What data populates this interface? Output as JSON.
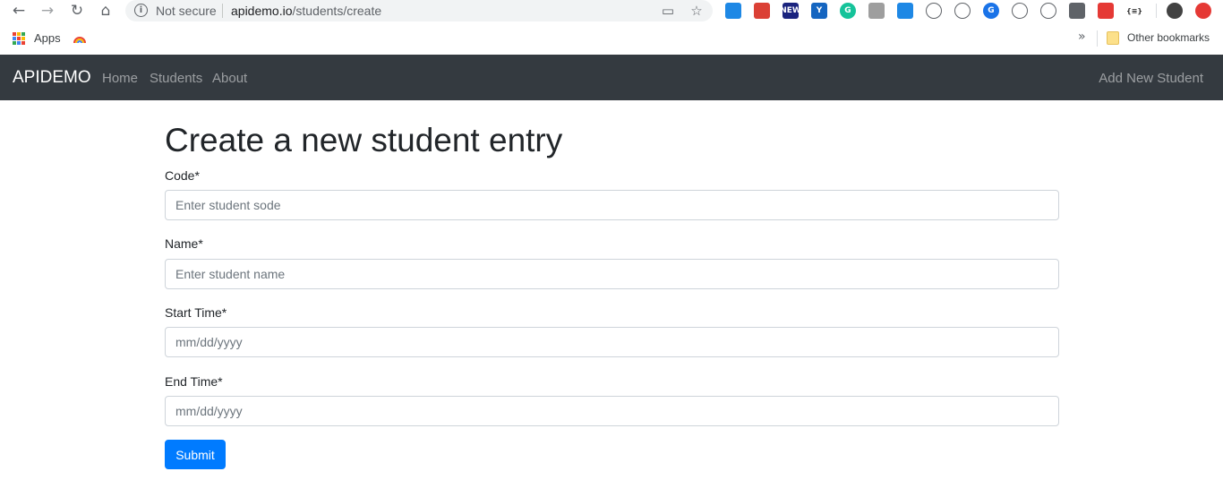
{
  "browser": {
    "security_label": "Not secure",
    "url_host": "apidemo.io",
    "url_path": "/students/create",
    "extensions": [
      {
        "name": "ext-blue-square-icon",
        "color": "#1e88e5"
      },
      {
        "name": "todoist-icon",
        "color": "#db4035"
      },
      {
        "name": "news-icon",
        "color": "#1a237e",
        "text": "NEW"
      },
      {
        "name": "y-check-icon",
        "color": "#1565c0",
        "text": "Y"
      },
      {
        "name": "grammarly-icon",
        "color": "#15c39a",
        "text": "G"
      },
      {
        "name": "profile-ext-icon",
        "color": "#9e9e9e"
      },
      {
        "name": "shield-check-icon",
        "color": "#1e88e5"
      },
      {
        "name": "lightning-icon",
        "color": "#ffffff"
      },
      {
        "name": "history-icon",
        "color": "#ffffff"
      },
      {
        "name": "g-circle-icon",
        "color": "#1a73e8",
        "text": "G"
      },
      {
        "name": "code-brackets-icon",
        "color": "#ffffff"
      },
      {
        "name": "c-clock-icon",
        "color": "#ffffff"
      },
      {
        "name": "map-pin-icon",
        "color": "#5f6368"
      },
      {
        "name": "color-grid-icon",
        "color": "#e53935"
      },
      {
        "name": "json-icon",
        "color": "#ffffff",
        "text": "{≡}"
      },
      {
        "name": "avatar-icon",
        "color": "#424242"
      },
      {
        "name": "update-arrow-icon",
        "color": "#e53935"
      }
    ]
  },
  "bookmarks": {
    "apps_label": "Apps",
    "other_label": "Other bookmarks"
  },
  "navbar": {
    "brand": "APIDEMO",
    "links": [
      "Home",
      "Students",
      "About"
    ],
    "right_link": "Add New Student"
  },
  "form": {
    "title": "Create a new student entry",
    "fields": [
      {
        "label": "Code*",
        "placeholder": "Enter student sode"
      },
      {
        "label": "Name*",
        "placeholder": "Enter student name"
      },
      {
        "label": "Start Time*",
        "placeholder": "mm/dd/yyyy"
      },
      {
        "label": "End Time*",
        "placeholder": "mm/dd/yyyy"
      }
    ],
    "submit_label": "Submit"
  },
  "colors": {
    "navbar_bg": "#343a40",
    "primary": "#007bff"
  }
}
